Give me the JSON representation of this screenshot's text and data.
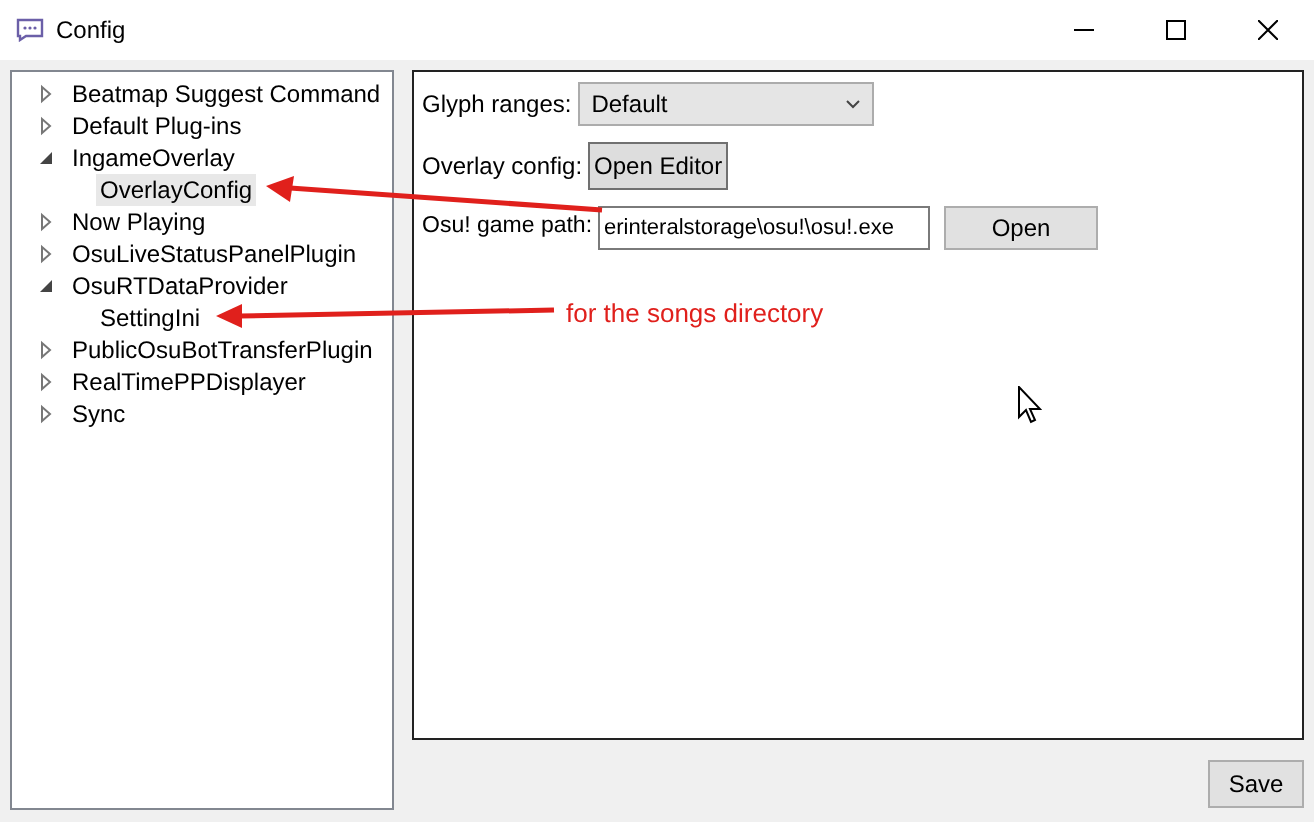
{
  "window": {
    "title": "Config"
  },
  "tree": [
    {
      "label": "Beatmap Suggest Command",
      "expanded": false,
      "selected": false
    },
    {
      "label": "Default Plug-ins",
      "expanded": false,
      "selected": false
    },
    {
      "label": "IngameOverlay",
      "expanded": true,
      "selected": false,
      "children": [
        {
          "label": "OverlayConfig",
          "selected": true
        }
      ]
    },
    {
      "label": "Now Playing",
      "expanded": false,
      "selected": false
    },
    {
      "label": "OsuLiveStatusPanelPlugin",
      "expanded": false,
      "selected": false
    },
    {
      "label": "OsuRTDataProvider",
      "expanded": true,
      "selected": false,
      "children": [
        {
          "label": "SettingIni",
          "selected": false
        }
      ]
    },
    {
      "label": "PublicOsuBotTransferPlugin",
      "expanded": false,
      "selected": false
    },
    {
      "label": "RealTimePPDisplayer",
      "expanded": false,
      "selected": false
    },
    {
      "label": "Sync",
      "expanded": false,
      "selected": false
    }
  ],
  "settings": {
    "glyph_ranges": {
      "label": "Glyph ranges:",
      "value": "Default"
    },
    "overlay_config": {
      "label": "Overlay config:",
      "button": "Open Editor"
    },
    "game_path": {
      "label": "Osu! game path:",
      "value": "erinteralstorage\\osu!\\osu!.exe",
      "button": "Open"
    }
  },
  "annotation": {
    "text": "for the songs directory"
  },
  "save_button": "Save"
}
